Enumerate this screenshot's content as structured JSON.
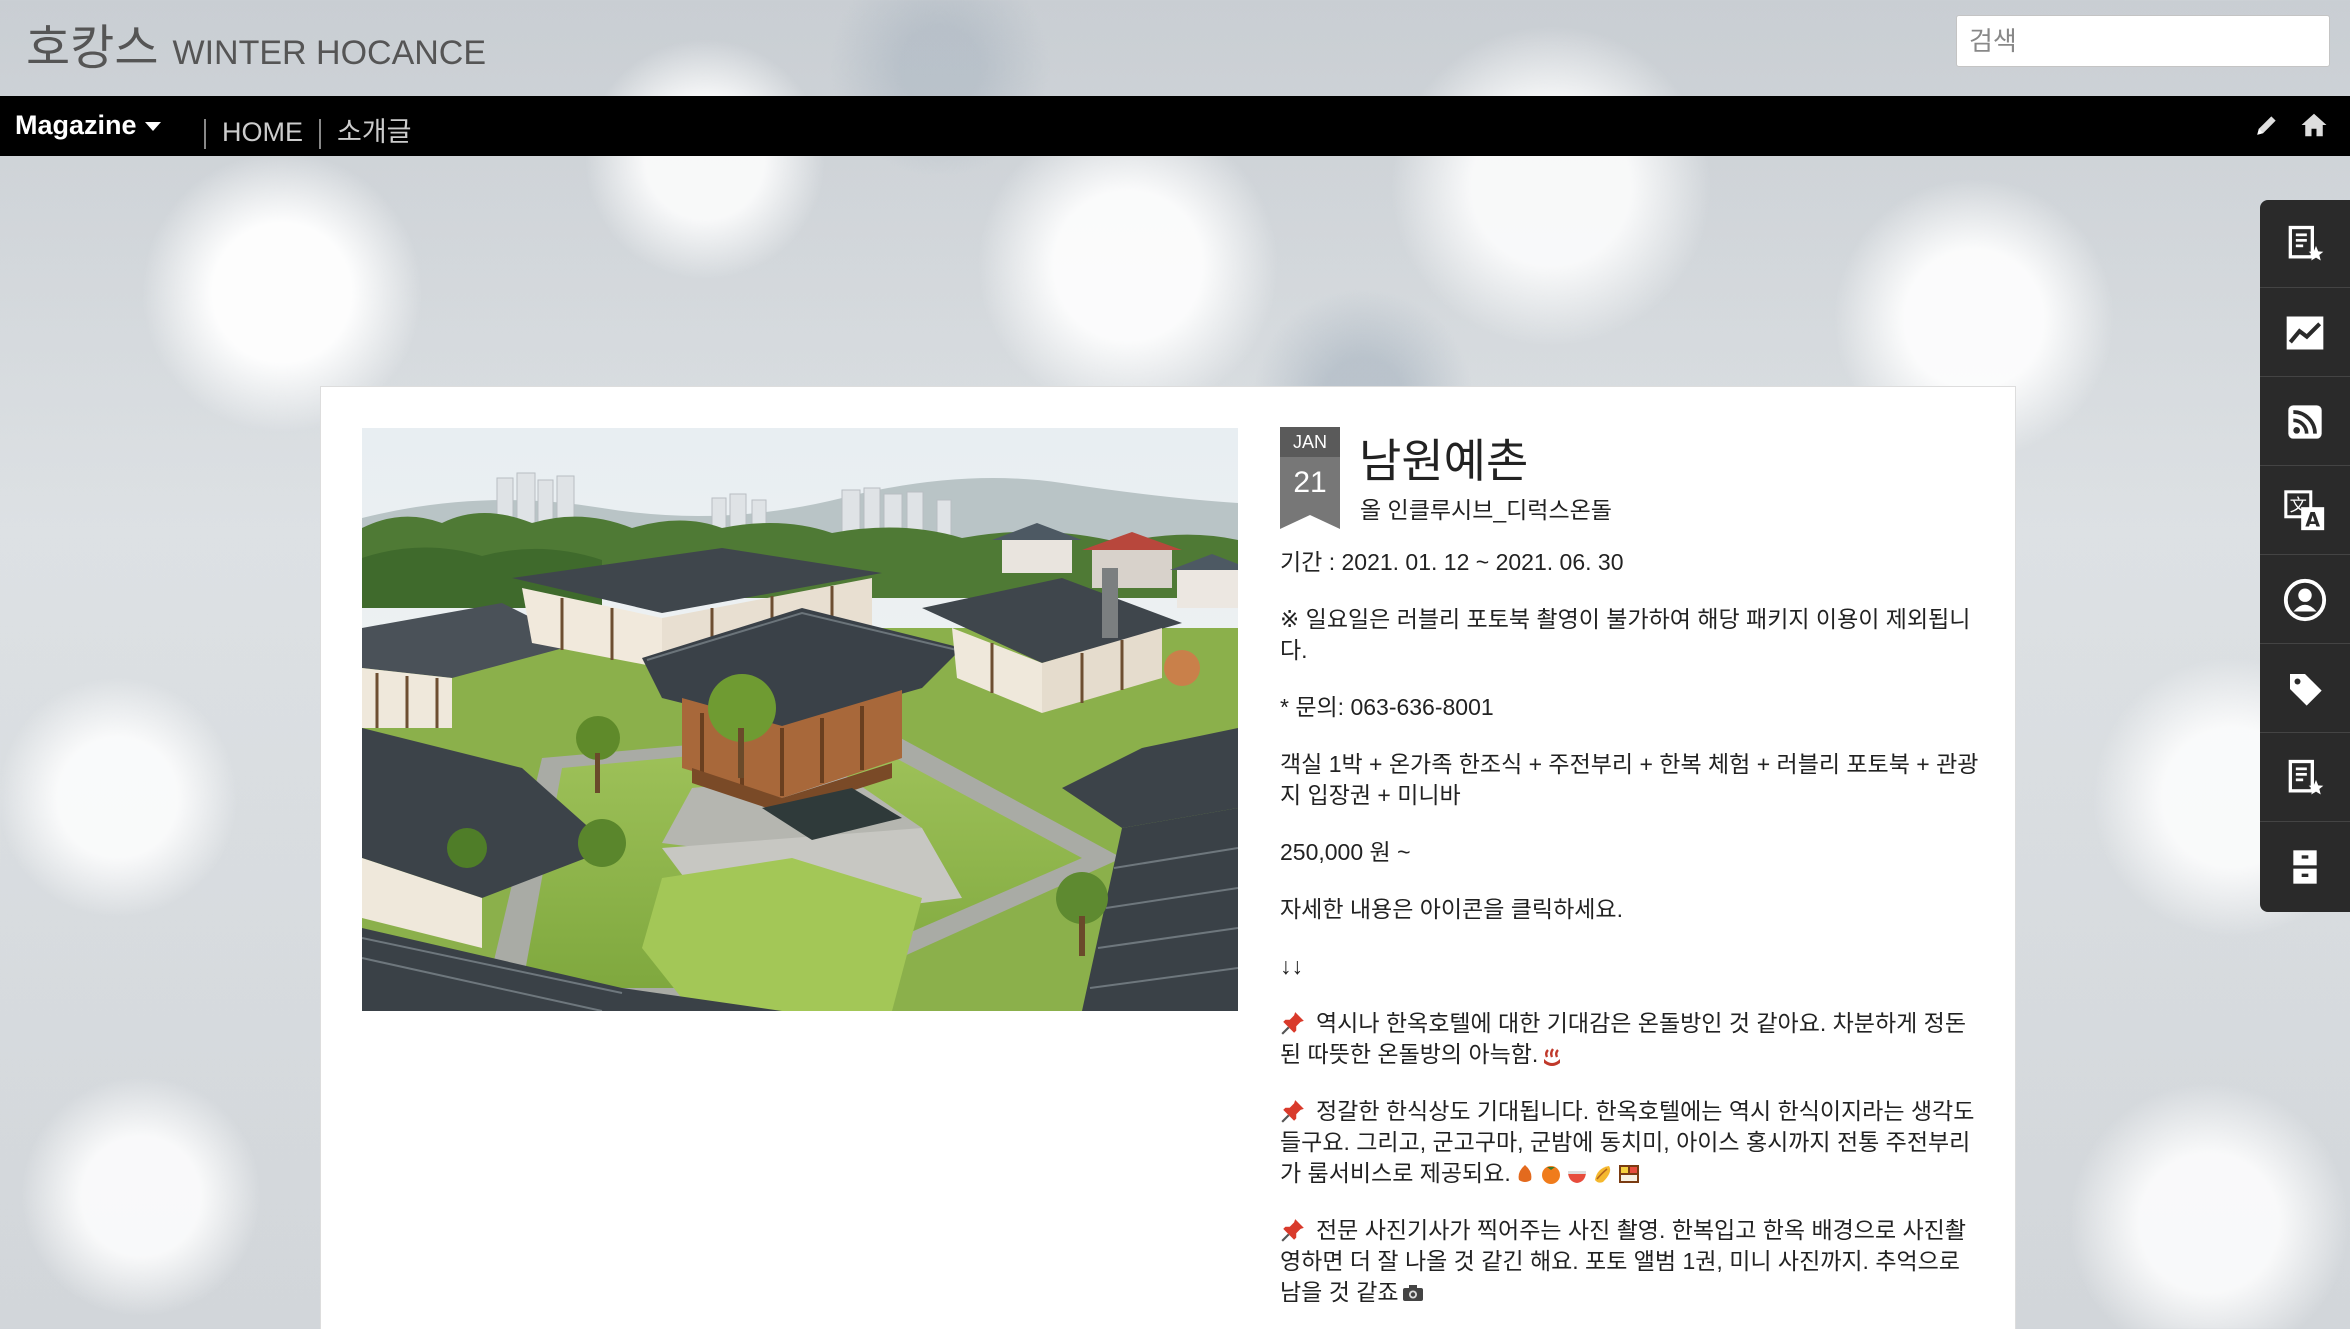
{
  "site": {
    "title_ko": "호캉스",
    "title_en": "WINTER HOCANCE",
    "search_placeholder": "검색"
  },
  "nav": {
    "magazine_label": "Magazine",
    "home_label": "HOME",
    "about_label": "소개글",
    "icons": [
      "pencil-icon",
      "home-icon"
    ]
  },
  "dock": {
    "items": [
      {
        "icon": "document-star-icon"
      },
      {
        "icon": "chart-line-icon"
      },
      {
        "icon": "rss-icon"
      },
      {
        "icon": "translate-icon"
      },
      {
        "icon": "user-circle-icon"
      },
      {
        "icon": "tag-icon"
      },
      {
        "icon": "document-star-icon"
      },
      {
        "icon": "archive-icon"
      }
    ]
  },
  "post": {
    "date_month": "JAN",
    "date_day": "21",
    "title": "남원예촌",
    "subtitle": "올 인클루시브_디럭스온돌",
    "period": "기간 : 2021. 01. 12 ~ 2021. 06. 30",
    "notice": "※ 일요일은 러블리 포토북 촬영이 불가하여 해당 패키지 이용이 제외됩니다.",
    "contact": "* 문의: 063-636-8001",
    "package": "객실 1박 + 온가족 한조식 + 주전부리 + 한복 체험 + 러블리 포토북 + 관광지 입장권 + 미니바",
    "price": "250,000 원 ~",
    "click_info": "자세한 내용은 아이콘을 클릭하세요.",
    "arrows": "↓↓",
    "highlight_1": "역시나 한옥호텔에 대한 기대감은 온돌방인 것 같아요. 차분하게 정돈된 따뜻한 온돌방의 아늑함.",
    "highlight_2": "정갈한 한식상도 기대됩니다. 한옥호텔에는 역시 한식이지라는 생각도 들구요. 그리고, 군고구마, 군밤에 동치미, 아이스 홍시까지 전통 주전부리가 룸서비스로 제공되요.",
    "highlight_3": "전문 사진기사가 찍어주는 사진 촬영. 한복입고 한옥 배경으로 사진촬영하면 더 잘 나올 것 같긴 해요. 포토 앨범 1권, 미니 사진까지. 추억으로 남을 것 같죠"
  },
  "colors": {
    "nav_bg": "#000000",
    "dock_bg": "#2a2a2a",
    "badge_month": "#5a5a5a",
    "badge_day": "#777777"
  }
}
